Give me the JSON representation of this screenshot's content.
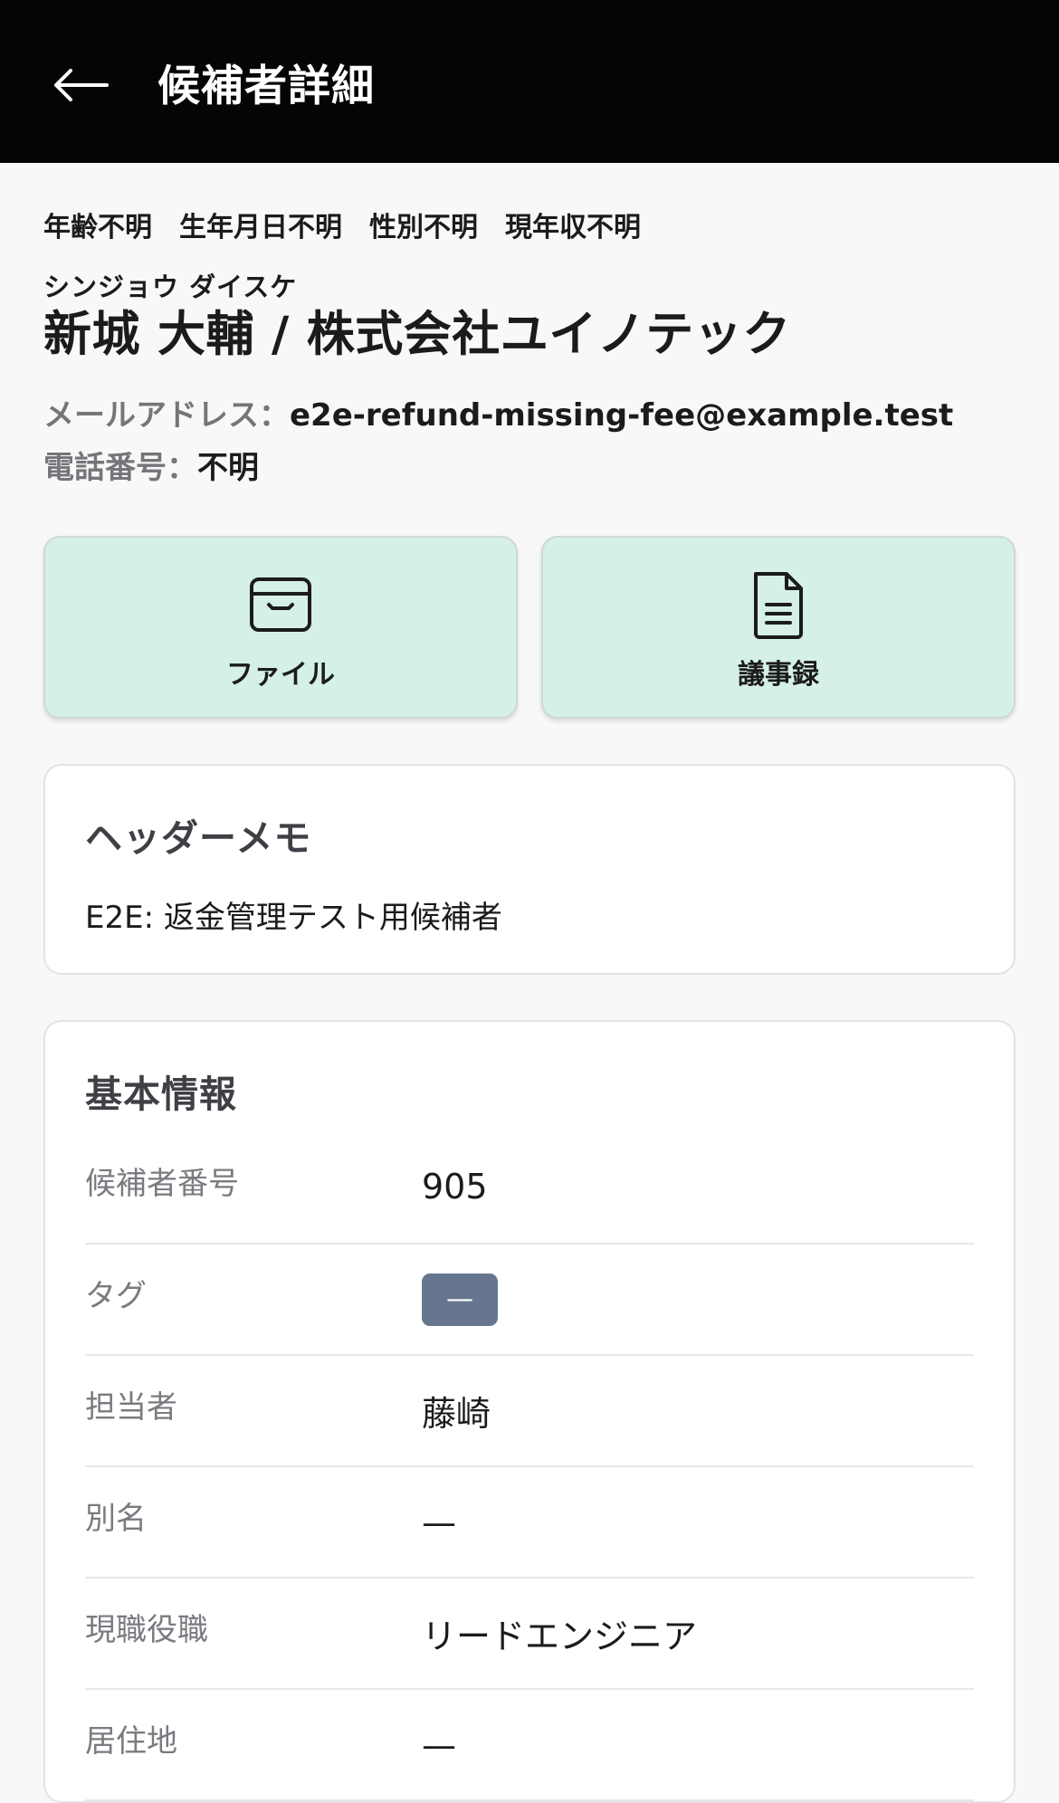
{
  "header": {
    "title": "候補者詳細"
  },
  "candidate": {
    "meta": [
      "年齢不明",
      "生年月日不明",
      "性別不明",
      "現年収不明"
    ],
    "kana": "シンジョウ ダイスケ",
    "name_line": "新城 大輔 / 株式会社ユイノテック",
    "email_label": "メールアドレス：",
    "email": "e2e-refund-missing-fee@example.test",
    "phone_label": "電話番号：",
    "phone": "不明"
  },
  "actions": {
    "file_label": "ファイル",
    "minutes_label": "議事録"
  },
  "header_memo": {
    "title": "ヘッダーメモ",
    "text": "E2E: 返金管理テスト用候補者"
  },
  "basic_info": {
    "title": "基本情報",
    "rows": [
      {
        "label": "候補者番号",
        "value": "905"
      },
      {
        "label": "タグ",
        "value": "—"
      },
      {
        "label": "担当者",
        "value": "藤崎"
      },
      {
        "label": "別名",
        "value": "—"
      },
      {
        "label": "現職役職",
        "value": "リードエンジニア"
      },
      {
        "label": "居住地",
        "value": "—"
      }
    ]
  },
  "colors": {
    "topbar": "#050505",
    "action_bg": "#d5f0e7",
    "tag_bg": "#66768f"
  },
  "icons": {
    "back": "left-arrow-icon",
    "file": "folder-icon",
    "minutes": "document-icon"
  }
}
